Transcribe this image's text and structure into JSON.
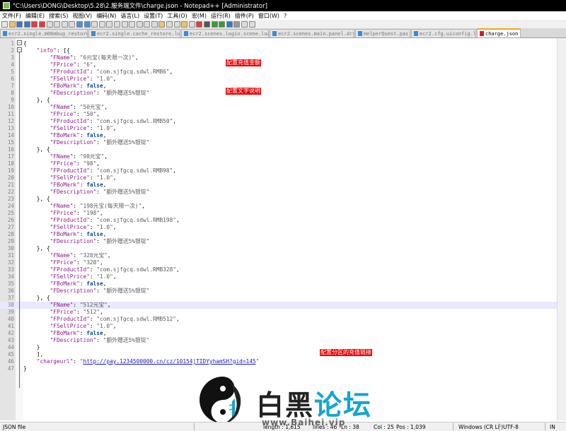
{
  "window": {
    "title": "\"C:\\Users\\DONG\\Desktop\\5.28\\2.服务端文件\\charge.json - Notepad++ [Administrator]"
  },
  "menu": [
    "文件(F)",
    "编辑(E)",
    "搜索(S)",
    "视图(V)",
    "编码(N)",
    "语言(L)",
    "设置(T)",
    "工具(O)",
    "宏(M)",
    "运行(R)",
    "插件(P)",
    "窗口(W)",
    "?"
  ],
  "tabs": [
    {
      "label": "ecr2.single.m06mbug_restore.lua",
      "active": false
    },
    {
      "label": "ecr2.single.cache_restore.lua",
      "active": false
    },
    {
      "label": "ecr2.scenes.login.scene.lua",
      "active": false
    },
    {
      "label": "ecr2.scenes.main.panel.dry.lua",
      "active": false
    },
    {
      "label": "HelperQuest.pas",
      "active": false
    },
    {
      "label": "ecr2.cfg.uiconfig.lua",
      "active": false
    },
    {
      "label": "charge.json",
      "active": true
    }
  ],
  "editor": {
    "current_line": 38,
    "lines": [
      [
        {
          "t": "p",
          "v": "{"
        }
      ],
      [
        {
          "t": "p",
          "v": "    "
        },
        {
          "t": "k",
          "v": "\"info\""
        },
        {
          "t": "p",
          "v": ": [{"
        }
      ],
      [
        {
          "t": "p",
          "v": "        "
        },
        {
          "t": "k",
          "v": "\"FName\""
        },
        {
          "t": "p",
          "v": ": "
        },
        {
          "t": "s",
          "v": "\"6元宝(每天限一次)\""
        },
        {
          "t": "p",
          "v": ","
        }
      ],
      [
        {
          "t": "p",
          "v": "        "
        },
        {
          "t": "k",
          "v": "\"FPrice\""
        },
        {
          "t": "p",
          "v": ": "
        },
        {
          "t": "s",
          "v": "\"6\""
        },
        {
          "t": "p",
          "v": ","
        }
      ],
      [
        {
          "t": "p",
          "v": "        "
        },
        {
          "t": "k",
          "v": "\"FProductId\""
        },
        {
          "t": "p",
          "v": ": "
        },
        {
          "t": "s",
          "v": "\"com.sjfgcq.sdwl.RMB6\""
        },
        {
          "t": "p",
          "v": ","
        }
      ],
      [
        {
          "t": "p",
          "v": "        "
        },
        {
          "t": "k",
          "v": "\"FSellPrice\""
        },
        {
          "t": "p",
          "v": ": "
        },
        {
          "t": "s",
          "v": "\"1.0\""
        },
        {
          "t": "p",
          "v": ","
        }
      ],
      [
        {
          "t": "p",
          "v": "        "
        },
        {
          "t": "k",
          "v": "\"FBoMark\""
        },
        {
          "t": "p",
          "v": ": "
        },
        {
          "t": "b",
          "v": "false"
        },
        {
          "t": "p",
          "v": ","
        }
      ],
      [
        {
          "t": "p",
          "v": "        "
        },
        {
          "t": "k",
          "v": "\"FDescription\""
        },
        {
          "t": "p",
          "v": ": "
        },
        {
          "t": "s",
          "v": "\"额外赠送5%银锭\""
        }
      ],
      [
        {
          "t": "p",
          "v": "    }, {"
        }
      ],
      [
        {
          "t": "p",
          "v": "        "
        },
        {
          "t": "k",
          "v": "\"FName\""
        },
        {
          "t": "p",
          "v": ": "
        },
        {
          "t": "s",
          "v": "\"50元宝\""
        },
        {
          "t": "p",
          "v": ","
        }
      ],
      [
        {
          "t": "p",
          "v": "        "
        },
        {
          "t": "k",
          "v": "\"FPrice\""
        },
        {
          "t": "p",
          "v": ": "
        },
        {
          "t": "s",
          "v": "\"50\""
        },
        {
          "t": "p",
          "v": ","
        }
      ],
      [
        {
          "t": "p",
          "v": "        "
        },
        {
          "t": "k",
          "v": "\"FProductId\""
        },
        {
          "t": "p",
          "v": ": "
        },
        {
          "t": "s",
          "v": "\"com.sjfgcq.sdwl.RMB50\""
        },
        {
          "t": "p",
          "v": ","
        }
      ],
      [
        {
          "t": "p",
          "v": "        "
        },
        {
          "t": "k",
          "v": "\"FSellPrice\""
        },
        {
          "t": "p",
          "v": ": "
        },
        {
          "t": "s",
          "v": "\"1.0\""
        },
        {
          "t": "p",
          "v": ","
        }
      ],
      [
        {
          "t": "p",
          "v": "        "
        },
        {
          "t": "k",
          "v": "\"FBoMark\""
        },
        {
          "t": "p",
          "v": ": "
        },
        {
          "t": "b",
          "v": "false"
        },
        {
          "t": "p",
          "v": ","
        }
      ],
      [
        {
          "t": "p",
          "v": "        "
        },
        {
          "t": "k",
          "v": "\"FDescription\""
        },
        {
          "t": "p",
          "v": ": "
        },
        {
          "t": "s",
          "v": "\"额外赠送5%银锭\""
        }
      ],
      [
        {
          "t": "p",
          "v": "    }, {"
        }
      ],
      [
        {
          "t": "p",
          "v": "        "
        },
        {
          "t": "k",
          "v": "\"FName\""
        },
        {
          "t": "p",
          "v": ": "
        },
        {
          "t": "s",
          "v": "\"98元宝\""
        },
        {
          "t": "p",
          "v": ","
        }
      ],
      [
        {
          "t": "p",
          "v": "        "
        },
        {
          "t": "k",
          "v": "\"FPrice\""
        },
        {
          "t": "p",
          "v": ": "
        },
        {
          "t": "s",
          "v": "\"98\""
        },
        {
          "t": "p",
          "v": ","
        }
      ],
      [
        {
          "t": "p",
          "v": "        "
        },
        {
          "t": "k",
          "v": "\"FProductId\""
        },
        {
          "t": "p",
          "v": ": "
        },
        {
          "t": "s",
          "v": "\"com.sjfgcq.sdwl.RMB98\""
        },
        {
          "t": "p",
          "v": ","
        }
      ],
      [
        {
          "t": "p",
          "v": "        "
        },
        {
          "t": "k",
          "v": "\"FSellPrice\""
        },
        {
          "t": "p",
          "v": ": "
        },
        {
          "t": "s",
          "v": "\"1.0\""
        },
        {
          "t": "p",
          "v": ","
        }
      ],
      [
        {
          "t": "p",
          "v": "        "
        },
        {
          "t": "k",
          "v": "\"FBoMark\""
        },
        {
          "t": "p",
          "v": ": "
        },
        {
          "t": "b",
          "v": "false"
        },
        {
          "t": "p",
          "v": ","
        }
      ],
      [
        {
          "t": "p",
          "v": "        "
        },
        {
          "t": "k",
          "v": "\"FDescription\""
        },
        {
          "t": "p",
          "v": ": "
        },
        {
          "t": "s",
          "v": "\"额外赠送5%银锭\""
        }
      ],
      [
        {
          "t": "p",
          "v": "    }, {"
        }
      ],
      [
        {
          "t": "p",
          "v": "        "
        },
        {
          "t": "k",
          "v": "\"FName\""
        },
        {
          "t": "p",
          "v": ": "
        },
        {
          "t": "s",
          "v": "\"198元宝(每天限一次)\""
        },
        {
          "t": "p",
          "v": ","
        }
      ],
      [
        {
          "t": "p",
          "v": "        "
        },
        {
          "t": "k",
          "v": "\"FPrice\""
        },
        {
          "t": "p",
          "v": ": "
        },
        {
          "t": "s",
          "v": "\"198\""
        },
        {
          "t": "p",
          "v": ","
        }
      ],
      [
        {
          "t": "p",
          "v": "        "
        },
        {
          "t": "k",
          "v": "\"FProductId\""
        },
        {
          "t": "p",
          "v": ": "
        },
        {
          "t": "s",
          "v": "\"com.sjfgcq.sdwl.RMB198\""
        },
        {
          "t": "p",
          "v": ","
        }
      ],
      [
        {
          "t": "p",
          "v": "        "
        },
        {
          "t": "k",
          "v": "\"FSellPrice\""
        },
        {
          "t": "p",
          "v": ": "
        },
        {
          "t": "s",
          "v": "\"1.0\""
        },
        {
          "t": "p",
          "v": ","
        }
      ],
      [
        {
          "t": "p",
          "v": "        "
        },
        {
          "t": "k",
          "v": "\"FBoMark\""
        },
        {
          "t": "p",
          "v": ": "
        },
        {
          "t": "b",
          "v": "false"
        },
        {
          "t": "p",
          "v": ","
        }
      ],
      [
        {
          "t": "p",
          "v": "        "
        },
        {
          "t": "k",
          "v": "\"FDescription\""
        },
        {
          "t": "p",
          "v": ": "
        },
        {
          "t": "s",
          "v": "\"额外赠送5%银锭\""
        }
      ],
      [
        {
          "t": "p",
          "v": "    }, {"
        }
      ],
      [
        {
          "t": "p",
          "v": "        "
        },
        {
          "t": "k",
          "v": "\"FName\""
        },
        {
          "t": "p",
          "v": ": "
        },
        {
          "t": "s",
          "v": "\"328元宝\""
        },
        {
          "t": "p",
          "v": ","
        }
      ],
      [
        {
          "t": "p",
          "v": "        "
        },
        {
          "t": "k",
          "v": "\"FPrice\""
        },
        {
          "t": "p",
          "v": ": "
        },
        {
          "t": "s",
          "v": "\"328\""
        },
        {
          "t": "p",
          "v": ","
        }
      ],
      [
        {
          "t": "p",
          "v": "        "
        },
        {
          "t": "k",
          "v": "\"FProductId\""
        },
        {
          "t": "p",
          "v": ": "
        },
        {
          "t": "s",
          "v": "\"com.sjfgcq.sdwl.RMB328\""
        },
        {
          "t": "p",
          "v": ","
        }
      ],
      [
        {
          "t": "p",
          "v": "        "
        },
        {
          "t": "k",
          "v": "\"FSellPrice\""
        },
        {
          "t": "p",
          "v": ": "
        },
        {
          "t": "s",
          "v": "\"1.0\""
        },
        {
          "t": "p",
          "v": ","
        }
      ],
      [
        {
          "t": "p",
          "v": "        "
        },
        {
          "t": "k",
          "v": "\"FBoMark\""
        },
        {
          "t": "p",
          "v": ": "
        },
        {
          "t": "b",
          "v": "false"
        },
        {
          "t": "p",
          "v": ","
        }
      ],
      [
        {
          "t": "p",
          "v": "        "
        },
        {
          "t": "k",
          "v": "\"FDescription\""
        },
        {
          "t": "p",
          "v": ": "
        },
        {
          "t": "s",
          "v": "\"额外赠送5%银锭\""
        }
      ],
      [
        {
          "t": "p",
          "v": "    }, {"
        }
      ],
      [
        {
          "t": "p",
          "v": "        "
        },
        {
          "t": "k",
          "v": "\"FName\""
        },
        {
          "t": "p",
          "v": ": "
        },
        {
          "t": "s",
          "v": "\"512元宝\""
        },
        {
          "t": "p",
          "v": ","
        }
      ],
      [
        {
          "t": "p",
          "v": "        "
        },
        {
          "t": "k",
          "v": "\"FPrice\""
        },
        {
          "t": "p",
          "v": ": "
        },
        {
          "t": "s",
          "v": "\"512\""
        },
        {
          "t": "p",
          "v": ","
        }
      ],
      [
        {
          "t": "p",
          "v": "        "
        },
        {
          "t": "k",
          "v": "\"FProductId\""
        },
        {
          "t": "p",
          "v": ": "
        },
        {
          "t": "s",
          "v": "\"com.sjfgcq.sdwl.RMB512\""
        },
        {
          "t": "p",
          "v": ","
        }
      ],
      [
        {
          "t": "p",
          "v": "        "
        },
        {
          "t": "k",
          "v": "\"FSellPrice\""
        },
        {
          "t": "p",
          "v": ": "
        },
        {
          "t": "s",
          "v": "\"1.0\""
        },
        {
          "t": "p",
          "v": ","
        }
      ],
      [
        {
          "t": "p",
          "v": "        "
        },
        {
          "t": "k",
          "v": "\"FBoMark\""
        },
        {
          "t": "p",
          "v": ": "
        },
        {
          "t": "b",
          "v": "false"
        },
        {
          "t": "p",
          "v": ","
        }
      ],
      [
        {
          "t": "p",
          "v": "        "
        },
        {
          "t": "k",
          "v": "\"FDescription\""
        },
        {
          "t": "p",
          "v": ": "
        },
        {
          "t": "s",
          "v": "\"额外赠送5%银锭\""
        }
      ],
      [
        {
          "t": "p",
          "v": "    }"
        }
      ],
      [
        {
          "t": "p",
          "v": "    ],"
        }
      ],
      [
        {
          "t": "p",
          "v": "    "
        },
        {
          "t": "k",
          "v": "\"chargeurl\""
        },
        {
          "t": "p",
          "v": ": "
        },
        {
          "t": "s",
          "v": "\""
        },
        {
          "t": "u",
          "v": "http://pay.1234500000.cn/cz/10154jTIDYyhamSH?gid=145"
        },
        {
          "t": "s",
          "v": "\""
        }
      ],
      [
        {
          "t": "p",
          "v": "}"
        }
      ]
    ]
  },
  "annotations": {
    "recharge_amount": "配置充值金额",
    "text_desc": "配置文字说明",
    "server_link": "配置分区的充值链接"
  },
  "status": {
    "filetype": "JSON file",
    "length": "length : 1,615",
    "lines": "lines : 46",
    "ln": "Ln : 38",
    "col": "Col : 25",
    "pos": "Pos : 1,039",
    "eol": "Windows (CR LF)",
    "encoding": "UTF-8",
    "mode": "IN"
  },
  "watermark": {
    "brand_dark": "白黑",
    "brand_blue": "论坛",
    "url": "www.Baihei.vip"
  },
  "colors": {
    "accent": "#ee0000",
    "keyword": "#8b1a8b",
    "boolean": "#0b4d9b",
    "link": "#1a1ab8",
    "brand_blue": "#15a5cf"
  }
}
